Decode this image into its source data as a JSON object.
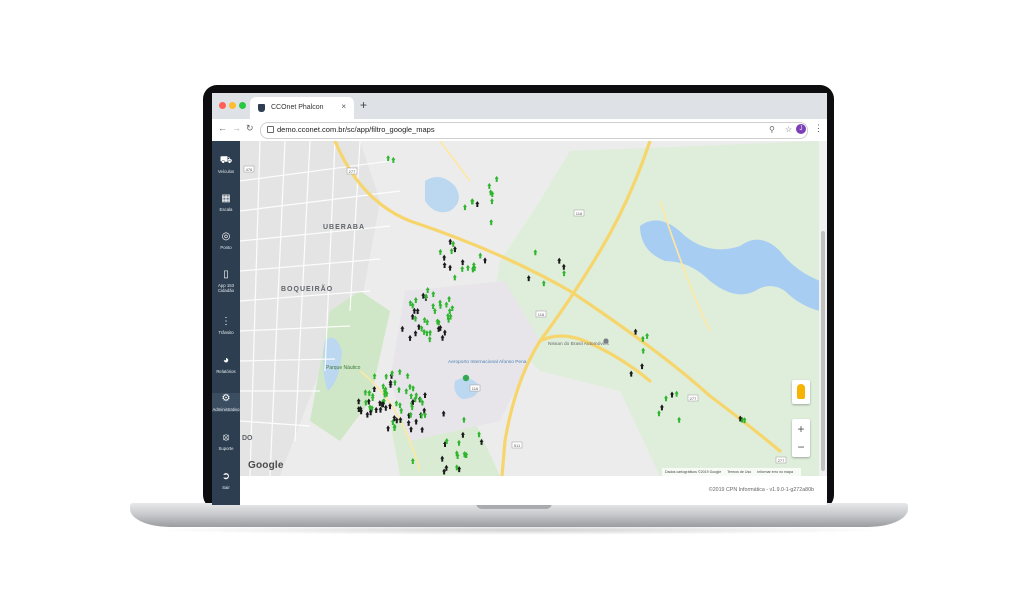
{
  "browser": {
    "tab_title": "CCOnet Phalcon",
    "tab_close": "×",
    "new_tab": "+",
    "url": "demo.cconet.com.br/sc/app/filtro_google_maps",
    "back_icon": "arrow-left-icon",
    "forward_icon": "arrow-right-icon",
    "reload_icon": "reload-icon",
    "profile_initial": "J",
    "colors": {
      "close": "#ff5f57",
      "minimize": "#febc2e",
      "maximize": "#28c840",
      "profile": "#7b3fb8"
    }
  },
  "sidebar": {
    "background": "#2d3e50",
    "items": [
      {
        "label": "Veículos",
        "icon": "car-icon"
      },
      {
        "label": "Escala",
        "icon": "calendar-icon"
      },
      {
        "label": "Ponto",
        "icon": "fingerprint-icon"
      },
      {
        "label": "App 153 Cidadão",
        "icon": "smartphone-icon"
      },
      {
        "label": "Trânsito",
        "icon": "traffic-light-icon"
      },
      {
        "label": "Relatórios",
        "icon": "pie-chart-icon"
      },
      {
        "label": "Administrativo",
        "icon": "gears-icon"
      },
      {
        "label": "Suporte",
        "icon": "lifebuoy-icon"
      },
      {
        "label": "Sair",
        "icon": "sign-out-icon"
      }
    ]
  },
  "map": {
    "labels": {
      "uberaba": "UBERABA",
      "boqueirao": "BOQUEIRÃO",
      "parque_nautico": "Parque Náutico",
      "airport": "Aeroporto Internacional Afonso Pena",
      "nissan": "Nissan do Brasil Automóveis",
      "do": "DO"
    },
    "road_shields": [
      "476",
      "277",
      "116",
      "116",
      "116",
      "277",
      "511",
      "277"
    ],
    "marker_colors": {
      "green": "#2fb52f",
      "black": "#1a1a1a"
    },
    "google_logo": "Google",
    "attribution": [
      "Dados cartográficos ©2019 Google",
      "Termos de Uso",
      "Informar erro no mapa"
    ],
    "zoom_in": "+",
    "zoom_out": "−"
  },
  "footer": {
    "copyright": "©2019 CPN Informática - v1.9.0-1-g272a80b"
  }
}
